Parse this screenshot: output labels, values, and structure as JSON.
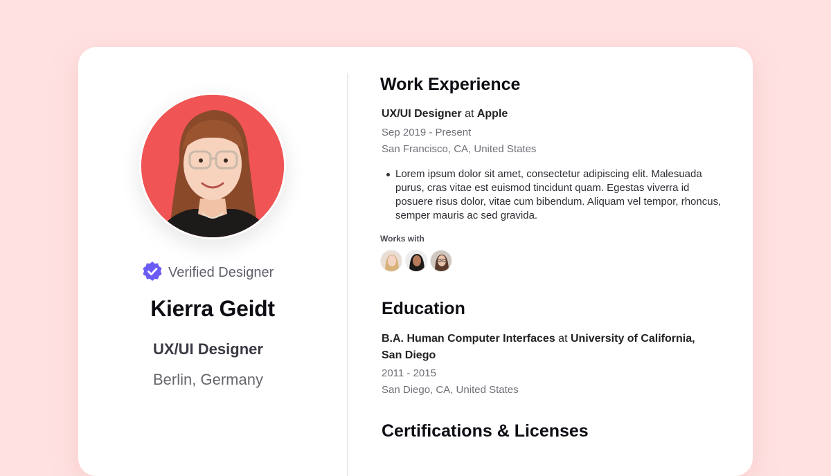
{
  "profile": {
    "verified_label": "Verified Designer",
    "name": "Kierra Geidt",
    "role": "UX/UI Designer",
    "location": "Berlin, Germany"
  },
  "experience": {
    "heading": "Work Experience",
    "job_title": "UX/UI Designer",
    "connector": "at",
    "company": "Apple",
    "dates": "Sep 2019 - Present",
    "location": "San Francisco, CA, United States",
    "bullet": "Lorem ipsum dolor sit amet, consectetur adipiscing elit. Malesuada purus, cras vitae est euismod tincidunt quam. Egestas viverra id posuere risus dolor, vitae cum bibendum. Aliquam vel tempor, rhoncus, semper mauris ac sed gravida.",
    "works_with_label": "Works with"
  },
  "education": {
    "heading": "Education",
    "degree": "B.A. Human Computer Interfaces",
    "connector": "at",
    "school": "University of California, San Diego",
    "dates": "2011 - 2015",
    "location": "San Diego, CA, United States"
  },
  "certifications": {
    "heading": "Certifications & Licenses"
  },
  "colors": {
    "background": "#ffe1e1",
    "avatar_bg": "#f05454",
    "verified_badge": "#6a5cf5"
  },
  "icons": {
    "verified": "verified-badge-icon"
  }
}
